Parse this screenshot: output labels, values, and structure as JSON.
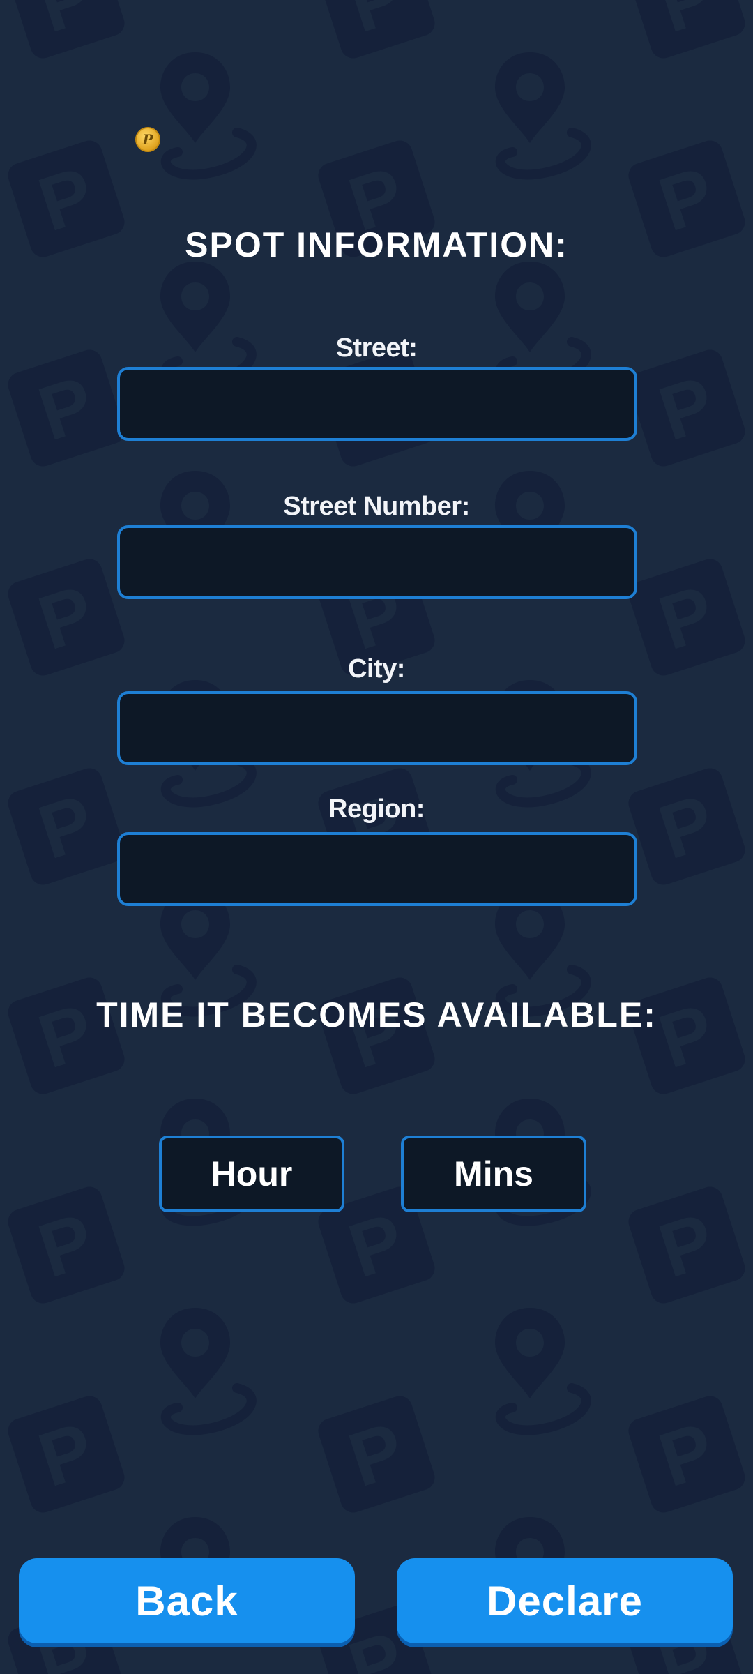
{
  "colors": {
    "background": "#1b2a40",
    "pattern": "#15213a",
    "field_fill": "#0d1826",
    "field_border": "#1e7fd4",
    "button": "#1690ee",
    "coin": "#e0a420"
  },
  "coin": {
    "icon": "coin-icon",
    "glyph": "P"
  },
  "spot_section": {
    "title": "SPOT INFORMATION:",
    "fields": [
      {
        "label": "Street:",
        "value": ""
      },
      {
        "label": "Street Number:",
        "value": ""
      },
      {
        "label": "City:",
        "value": ""
      },
      {
        "label": "Region:",
        "value": ""
      }
    ]
  },
  "time_section": {
    "title": "TIME IT BECOMES AVAILABLE:",
    "hour_label": "Hour",
    "mins_label": "Mins"
  },
  "actions": {
    "back_label": "Back",
    "declare_label": "Declare"
  }
}
